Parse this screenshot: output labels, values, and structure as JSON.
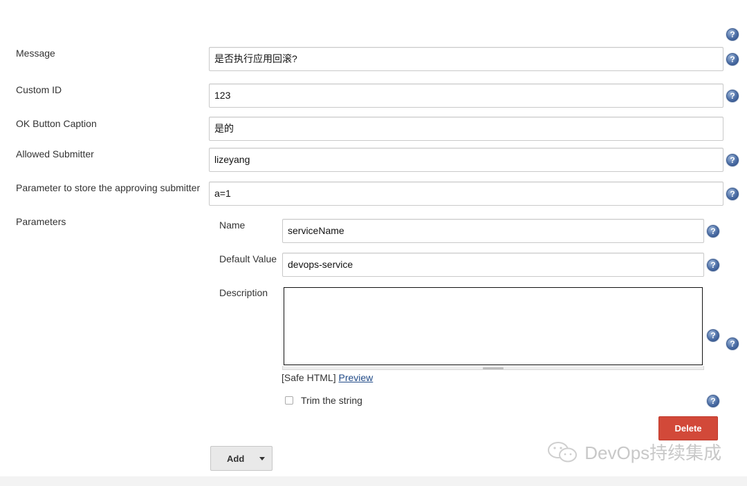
{
  "form": {
    "message": {
      "label": "Message",
      "value": "是否执行应用回滚?"
    },
    "custom_id": {
      "label": "Custom ID",
      "value": "123"
    },
    "ok_caption": {
      "label": "OK Button Caption",
      "value": "是的"
    },
    "allowed_submitter": {
      "label": "Allowed Submitter",
      "value": "lizeyang"
    },
    "submitter_param": {
      "label": "Parameter to store the approving submitter",
      "value": "a=1"
    },
    "parameters_label": "Parameters"
  },
  "parameter": {
    "name": {
      "label": "Name",
      "value": "serviceName"
    },
    "default_value": {
      "label": "Default Value",
      "value": "devops-service"
    },
    "description": {
      "label": "Description",
      "value": ""
    },
    "safe_html": "[Safe HTML]",
    "preview": "Preview",
    "trim": {
      "label": "Trim the string",
      "checked": false
    },
    "delete_label": "Delete"
  },
  "actions": {
    "add_label": "Add"
  },
  "help_glyph": "?",
  "watermark": "DevOps持续集成",
  "colors": {
    "delete": "#d24939",
    "help": "#4d6fa6",
    "link": "#204a87"
  }
}
